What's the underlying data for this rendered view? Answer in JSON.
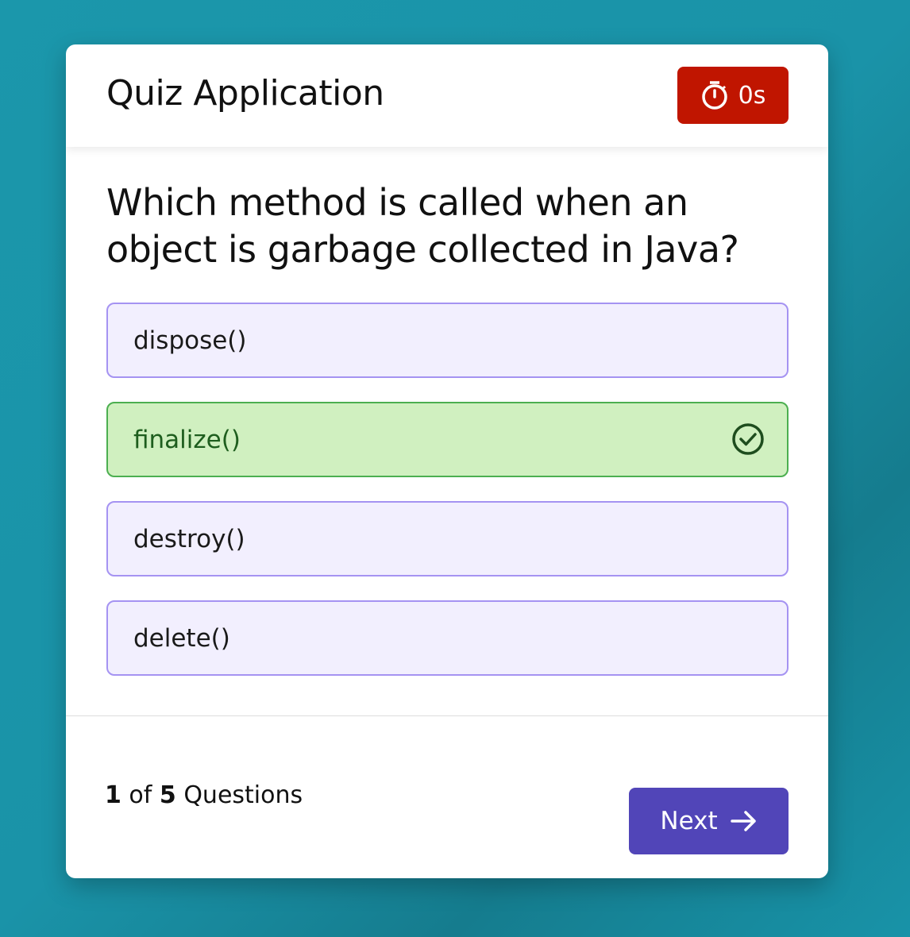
{
  "header": {
    "title": "Quiz Application",
    "timer": "0s"
  },
  "question": "Which method is called when an object is garbage collected in Java?",
  "options": [
    {
      "label": "dispose()",
      "state": "default"
    },
    {
      "label": "finalize()",
      "state": "correct"
    },
    {
      "label": "destroy()",
      "state": "default"
    },
    {
      "label": "delete()",
      "state": "default"
    }
  ],
  "footer": {
    "current": "1",
    "of": "of",
    "total": "5",
    "suffix": "Questions",
    "next_label": "Next"
  },
  "colors": {
    "timer": "#c01500",
    "next": "#5145b8",
    "correct_bg": "#d0f0c0",
    "option_bg": "#f2effe"
  }
}
